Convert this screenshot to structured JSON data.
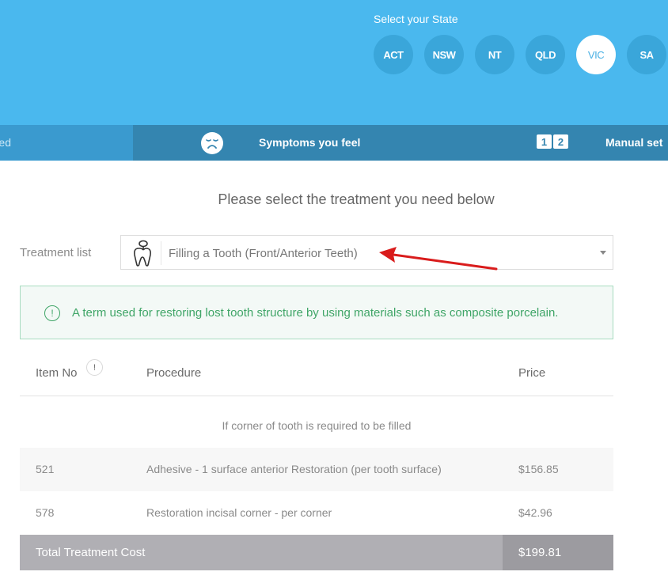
{
  "state_selector": {
    "title": "Select your State",
    "states": [
      {
        "label": "ACT",
        "active": false
      },
      {
        "label": "NSW",
        "active": false
      },
      {
        "label": "NT",
        "active": false
      },
      {
        "label": "QLD",
        "active": false
      },
      {
        "label": "VIC",
        "active": true
      },
      {
        "label": "SA",
        "active": false
      }
    ]
  },
  "steps": {
    "previous_label_fragment": "ed",
    "symptoms_icon": "sad-face-icon",
    "symptoms_label": "Symptoms you feel",
    "manual_icon": "numbers-1-2-icon",
    "manual_digits": [
      "1",
      "2"
    ],
    "manual_label": "Manual set"
  },
  "main": {
    "heading": "Please select the treatment you need below",
    "treatment_label": "Treatment list",
    "treatment_icon": "tooth-filling-icon",
    "treatment_selected": "Filling a Tooth (Front/Anterior Teeth)",
    "info_icon": "exclamation-circle-icon",
    "info_text": "A term used for restoring lost tooth structure by using materials such as composite porcelain."
  },
  "table": {
    "headers": {
      "item_no": "Item No",
      "help": "!",
      "procedure": "Procedure",
      "price": "Price"
    },
    "group_label": "If corner of tooth is required to be filled",
    "rows": [
      {
        "item_no": "521",
        "procedure": "Adhesive - 1 surface anterior Restoration (per tooth surface)",
        "price": "$156.85"
      },
      {
        "item_no": "578",
        "procedure": "Restoration incisal corner - per corner",
        "price": "$42.96"
      }
    ],
    "total_label": "Total Treatment Cost",
    "total_price": "$199.81"
  },
  "colors": {
    "hero_blue": "#4ab8ee",
    "stepbar_blue": "#3485b0",
    "info_green": "#3fa567",
    "annotation_arrow": "#d91c1c"
  }
}
